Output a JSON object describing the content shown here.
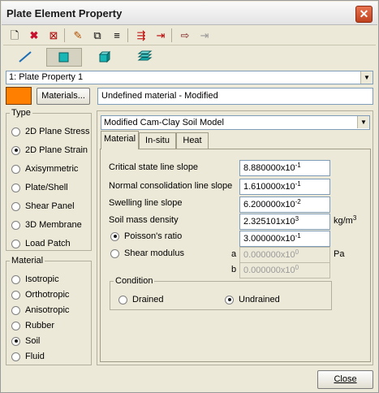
{
  "window": {
    "title": "Plate Element Property"
  },
  "toolbar": {
    "icons": [
      "new-icon",
      "delete-icon",
      "delete-unused-icon",
      "edit-icon",
      "copy-icon",
      "sort-icon",
      "import-icon",
      "export-icon",
      "export-to-icon",
      "exit-to-icon"
    ]
  },
  "shape_buttons": [
    "line-icon",
    "square-icon",
    "cube-icon",
    "layers-icon"
  ],
  "property": {
    "selected": "1: Plate Property 1"
  },
  "materials_button": "Materials...",
  "material_name": "Undefined material - Modified",
  "color": "#ff7f00",
  "type_group": {
    "legend": "Type",
    "options": [
      "2D Plane Stress",
      "2D Plane Strain",
      "Axisymmetric",
      "Plate/Shell",
      "Shear Panel",
      "3D Membrane",
      "Load Patch"
    ],
    "selected": "2D Plane Strain"
  },
  "material_group": {
    "legend": "Material",
    "options": [
      "Isotropic",
      "Orthotropic",
      "Anisotropic",
      "Rubber",
      "Soil",
      "Fluid"
    ],
    "selected": "Soil"
  },
  "model": {
    "selected": "Modified Cam-Clay Soil Model"
  },
  "tabs": [
    "Material",
    "In-situ",
    "Heat"
  ],
  "active_tab": "Material",
  "fields": {
    "critical_state": {
      "label": "Critical state line slope",
      "mantissa": "8.880000x10",
      "exp": "-1"
    },
    "normal_consolidation": {
      "label": "Normal consolidation line slope",
      "mantissa": "1.610000x10",
      "exp": "-1"
    },
    "swelling": {
      "label": "Swelling line slope",
      "mantissa": "6.200000x10",
      "exp": "-2"
    },
    "density": {
      "label": "Soil mass density",
      "mantissa": "2.325101x10",
      "exp": "3",
      "unit": "kg/m",
      "unit_exp": "3"
    },
    "poisson": {
      "label": "Poisson's ratio",
      "mantissa": "3.000000x10",
      "exp": "-1",
      "selected": true
    },
    "shear_a": {
      "label": "Shear modulus",
      "letter": "a",
      "mantissa": "0.000000x10",
      "exp": "0",
      "unit": "Pa"
    },
    "shear_b": {
      "letter": "b",
      "mantissa": "0.000000x10",
      "exp": "0"
    }
  },
  "condition": {
    "legend": "Condition",
    "options": [
      "Drained",
      "Undrained"
    ],
    "selected": "Undrained"
  },
  "close_button": "Close"
}
